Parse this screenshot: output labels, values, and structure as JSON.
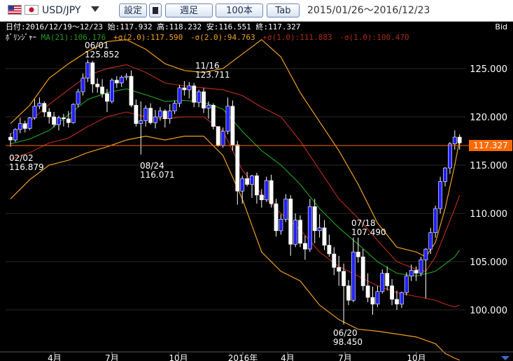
{
  "toolbar": {
    "pair": "USD/JPY",
    "settings": "設定",
    "timeframe": "週足",
    "count": "100本",
    "tab": "Tab",
    "range": "2015/01/26〜2016/12/23"
  },
  "colors": {
    "background": "#000000",
    "up_candle": "#2020ff",
    "down_candle": "#ffffff",
    "ma21": "#1f9a1f",
    "sigma2": "#f0a020",
    "sigma1": "#b02a1a",
    "price_line": "#ff6a00"
  },
  "info": {
    "line1": "日付:2016/12/19〜12/23 始:117.932 高:118.232 安:116.551 終:117.327",
    "label": "ﾎﾞﾘﾝｼﾞｬｰ",
    "ma": "MA(21):106.176",
    "p2": "+σ(2.0):117.590",
    "m2": "-σ(2.0):94.763",
    "p1": "+σ(1.0):111.883",
    "m1": "-σ(1.0):100.470",
    "bid": "Bid"
  },
  "chart_data": {
    "type": "candlestick",
    "y_ticks": [
      "125.000",
      "120.000",
      "115.000",
      "110.000",
      "105.000",
      "100.000"
    ],
    "x_ticks": [
      "4月",
      "7月",
      "10月",
      "2016年",
      "4月",
      "7月",
      "10月"
    ],
    "current_price": "117.327",
    "ylim": [
      96.2,
      130.3
    ],
    "annotations": [
      {
        "date": "06/01",
        "value": "125.852"
      },
      {
        "date": "11/16",
        "value": "123.711"
      },
      {
        "date": "02/02",
        "value": "116.879"
      },
      {
        "date": "08/24",
        "value": "116.071"
      },
      {
        "date": "07/18",
        "value": "107.490"
      },
      {
        "date": "06/20",
        "value": "98.450"
      }
    ],
    "candles": [
      [
        117.9,
        118.3,
        116.9,
        117.6
      ],
      [
        117.6,
        118.8,
        117.4,
        118.7
      ],
      [
        118.7,
        119.9,
        118.3,
        119.3
      ],
      [
        119.3,
        119.6,
        118.4,
        118.8
      ],
      [
        118.8,
        120.0,
        118.6,
        119.9
      ],
      [
        119.9,
        121.8,
        119.7,
        121.1
      ],
      [
        121.1,
        122.0,
        120.8,
        121.4
      ],
      [
        121.4,
        121.6,
        120.0,
        120.5
      ],
      [
        120.5,
        120.9,
        119.3,
        120.0
      ],
      [
        120.0,
        120.5,
        118.9,
        119.2
      ],
      [
        119.2,
        120.1,
        118.6,
        119.9
      ],
      [
        119.9,
        120.3,
        119.0,
        119.8
      ],
      [
        119.8,
        120.6,
        118.9,
        119.4
      ],
      [
        119.4,
        121.4,
        119.3,
        121.3
      ],
      [
        121.3,
        122.9,
        121.0,
        122.6
      ],
      [
        122.6,
        124.5,
        122.2,
        124.0
      ],
      [
        124.0,
        125.9,
        123.6,
        125.6
      ],
      [
        125.6,
        125.8,
        122.5,
        123.4
      ],
      [
        123.4,
        124.0,
        122.5,
        123.1
      ],
      [
        123.1,
        123.9,
        122.0,
        122.4
      ],
      [
        122.4,
        122.9,
        120.5,
        121.6
      ],
      [
        121.6,
        124.0,
        121.4,
        123.8
      ],
      [
        123.8,
        124.2,
        123.0,
        123.5
      ],
      [
        123.5,
        124.3,
        123.1,
        124.1
      ],
      [
        124.1,
        124.5,
        123.8,
        124.2
      ],
      [
        124.2,
        124.8,
        121.0,
        121.2
      ],
      [
        121.2,
        121.8,
        119.0,
        119.3
      ],
      [
        119.3,
        121.6,
        116.1,
        119.6
      ],
      [
        119.6,
        121.2,
        119.0,
        120.9
      ],
      [
        120.9,
        121.4,
        119.2,
        119.4
      ],
      [
        119.4,
        120.7,
        118.8,
        120.0
      ],
      [
        120.0,
        121.0,
        119.6,
        120.6
      ],
      [
        120.6,
        120.8,
        118.9,
        119.8
      ],
      [
        119.8,
        121.3,
        119.3,
        120.6
      ],
      [
        120.6,
        121.7,
        120.3,
        121.4
      ],
      [
        121.4,
        123.3,
        121.0,
        123.0
      ],
      [
        123.0,
        123.7,
        122.2,
        122.8
      ],
      [
        122.8,
        123.6,
        121.9,
        123.2
      ],
      [
        123.2,
        123.5,
        121.0,
        121.5
      ],
      [
        121.5,
        122.8,
        121.0,
        122.6
      ],
      [
        122.6,
        123.0,
        120.4,
        120.9
      ],
      [
        120.9,
        121.6,
        119.8,
        121.2
      ],
      [
        121.2,
        121.4,
        118.7,
        119.0
      ],
      [
        119.0,
        118.7,
        116.9,
        117.0
      ],
      [
        117.0,
        118.9,
        116.8,
        118.5
      ],
      [
        118.5,
        122.0,
        118.2,
        121.1
      ],
      [
        121.1,
        121.7,
        116.5,
        117.1
      ],
      [
        117.1,
        117.5,
        110.9,
        112.3
      ],
      [
        112.3,
        113.9,
        111.0,
        113.6
      ],
      [
        113.6,
        114.3,
        112.8,
        113.0
      ],
      [
        113.0,
        114.0,
        111.6,
        113.9
      ],
      [
        113.9,
        114.2,
        111.0,
        111.9
      ],
      [
        111.9,
        112.5,
        110.6,
        111.4
      ],
      [
        111.4,
        113.8,
        111.2,
        113.4
      ],
      [
        113.4,
        114.0,
        110.6,
        111.0
      ],
      [
        111.0,
        111.5,
        107.6,
        108.2
      ],
      [
        108.2,
        109.9,
        107.8,
        109.4
      ],
      [
        109.4,
        112.0,
        109.1,
        111.5
      ],
      [
        111.5,
        111.9,
        105.6,
        106.8
      ],
      [
        106.8,
        110.0,
        106.5,
        109.3
      ],
      [
        109.3,
        109.8,
        106.5,
        106.9
      ],
      [
        106.9,
        107.7,
        105.2,
        106.3
      ],
      [
        106.3,
        111.5,
        106.0,
        110.7
      ],
      [
        110.7,
        111.5,
        106.9,
        108.2
      ],
      [
        108.2,
        109.9,
        107.5,
        108.5
      ],
      [
        108.5,
        109.3,
        106.2,
        106.7
      ],
      [
        106.7,
        107.8,
        105.5,
        105.8
      ],
      [
        105.8,
        106.5,
        103.6,
        104.4
      ],
      [
        104.4,
        105.6,
        102.5,
        104.0
      ],
      [
        104.0,
        104.8,
        98.5,
        102.5
      ],
      [
        102.5,
        103.1,
        100.5,
        101.0
      ],
      [
        101.0,
        107.5,
        100.8,
        106.0
      ],
      [
        106.0,
        107.5,
        104.9,
        105.5
      ],
      [
        105.5,
        106.3,
        102.0,
        102.5
      ],
      [
        102.5,
        103.8,
        100.8,
        101.3
      ],
      [
        101.3,
        102.4,
        99.5,
        100.6
      ],
      [
        100.6,
        102.5,
        100.3,
        101.9
      ],
      [
        101.9,
        104.2,
        101.7,
        103.8
      ],
      [
        103.8,
        104.5,
        102.0,
        102.5
      ],
      [
        102.5,
        103.2,
        100.5,
        101.1
      ],
      [
        101.1,
        102.0,
        100.0,
        100.6
      ],
      [
        100.6,
        101.9,
        100.2,
        101.8
      ],
      [
        101.8,
        103.9,
        101.5,
        103.5
      ],
      [
        103.5,
        104.7,
        103.0,
        104.1
      ],
      [
        104.1,
        104.5,
        103.0,
        103.8
      ],
      [
        103.8,
        105.5,
        103.5,
        105.2
      ],
      [
        105.2,
        106.4,
        101.2,
        106.3
      ],
      [
        106.3,
        108.5,
        105.8,
        108.0
      ],
      [
        108.0,
        110.8,
        107.5,
        110.5
      ],
      [
        110.5,
        113.8,
        110.0,
        113.3
      ],
      [
        113.3,
        114.8,
        112.8,
        114.7
      ],
      [
        114.7,
        117.4,
        114.1,
        117.2
      ],
      [
        117.2,
        118.6,
        116.6,
        117.9
      ],
      [
        117.9,
        118.2,
        116.6,
        117.3
      ]
    ],
    "bands": {
      "ma21": [
        [
          0,
          117.2
        ],
        [
          4,
          117.7
        ],
        [
          8,
          118.6
        ],
        [
          12,
          120.2
        ],
        [
          16,
          121.8
        ],
        [
          20,
          122.5
        ],
        [
          24,
          122.9
        ],
        [
          28,
          122.3
        ],
        [
          32,
          121.6
        ],
        [
          36,
          121.7
        ],
        [
          40,
          121.5
        ],
        [
          44,
          120.8
        ],
        [
          48,
          118.5
        ],
        [
          52,
          116.5
        ],
        [
          56,
          115.0
        ],
        [
          60,
          113.0
        ],
        [
          64,
          110.5
        ],
        [
          68,
          108.5
        ],
        [
          72,
          106.8
        ],
        [
          76,
          105.0
        ],
        [
          80,
          103.8
        ],
        [
          84,
          103.5
        ],
        [
          88,
          104.0
        ],
        [
          92,
          105.5
        ],
        [
          93,
          106.2
        ]
      ],
      "p2": [
        [
          0,
          119.3
        ],
        [
          4,
          121.2
        ],
        [
          8,
          124.0
        ],
        [
          12,
          125.5
        ],
        [
          16,
          126.8
        ],
        [
          20,
          127.8
        ],
        [
          24,
          128.0
        ],
        [
          28,
          127.0
        ],
        [
          32,
          125.5
        ],
        [
          36,
          124.8
        ],
        [
          40,
          124.6
        ],
        [
          44,
          125.0
        ],
        [
          48,
          126.5
        ],
        [
          52,
          128.0
        ],
        [
          56,
          126.2
        ],
        [
          60,
          122.5
        ],
        [
          64,
          119.5
        ],
        [
          68,
          116.5
        ],
        [
          72,
          113.0
        ],
        [
          76,
          109.0
        ],
        [
          80,
          106.5
        ],
        [
          84,
          106.0
        ],
        [
          86,
          105.5
        ],
        [
          88,
          107.0
        ],
        [
          90,
          110.5
        ],
        [
          92,
          115.0
        ],
        [
          93,
          117.6
        ]
      ],
      "m2": [
        [
          0,
          111.5
        ],
        [
          4,
          113.5
        ],
        [
          8,
          115.0
        ],
        [
          12,
          115.5
        ],
        [
          16,
          116.3
        ],
        [
          20,
          116.9
        ],
        [
          24,
          117.6
        ],
        [
          28,
          118.0
        ],
        [
          32,
          117.6
        ],
        [
          36,
          118.0
        ],
        [
          40,
          118.0
        ],
        [
          44,
          116.0
        ],
        [
          48,
          111.5
        ],
        [
          52,
          106.0
        ],
        [
          56,
          104.0
        ],
        [
          60,
          103.0
        ],
        [
          64,
          100.5
        ],
        [
          68,
          99.0
        ],
        [
          72,
          98.0
        ],
        [
          76,
          97.8
        ],
        [
          80,
          97.5
        ],
        [
          84,
          97.2
        ],
        [
          88,
          96.5
        ],
        [
          90,
          95.5
        ],
        [
          92,
          95.0
        ],
        [
          93,
          94.8
        ]
      ],
      "p1": [
        [
          0,
          118.2
        ],
        [
          4,
          119.5
        ],
        [
          8,
          121.3
        ],
        [
          12,
          122.8
        ],
        [
          16,
          124.3
        ],
        [
          20,
          125.0
        ],
        [
          24,
          125.4
        ],
        [
          28,
          124.6
        ],
        [
          32,
          123.5
        ],
        [
          36,
          123.2
        ],
        [
          40,
          123.0
        ],
        [
          44,
          122.8
        ],
        [
          48,
          122.2
        ],
        [
          52,
          121.0
        ],
        [
          56,
          120.0
        ],
        [
          60,
          117.5
        ],
        [
          64,
          114.5
        ],
        [
          68,
          111.5
        ],
        [
          72,
          109.5
        ],
        [
          76,
          107.2
        ],
        [
          80,
          105.0
        ],
        [
          84,
          104.2
        ],
        [
          86,
          104.0
        ],
        [
          88,
          105.5
        ],
        [
          90,
          108.0
        ],
        [
          92,
          110.5
        ],
        [
          93,
          111.9
        ]
      ],
      "m1": [
        [
          0,
          115.6
        ],
        [
          4,
          116.3
        ],
        [
          8,
          117.3
        ],
        [
          12,
          117.8
        ],
        [
          16,
          119.0
        ],
        [
          20,
          120.0
        ],
        [
          24,
          120.5
        ],
        [
          28,
          120.0
        ],
        [
          32,
          119.8
        ],
        [
          36,
          120.0
        ],
        [
          40,
          120.0
        ],
        [
          44,
          118.5
        ],
        [
          48,
          114.5
        ],
        [
          52,
          112.0
        ],
        [
          56,
          110.0
        ],
        [
          60,
          108.3
        ],
        [
          64,
          106.0
        ],
        [
          68,
          104.5
        ],
        [
          72,
          103.5
        ],
        [
          76,
          102.5
        ],
        [
          80,
          101.8
        ],
        [
          84,
          101.4
        ],
        [
          88,
          101.0
        ],
        [
          90,
          100.6
        ],
        [
          92,
          100.3
        ],
        [
          93,
          100.5
        ]
      ]
    }
  }
}
